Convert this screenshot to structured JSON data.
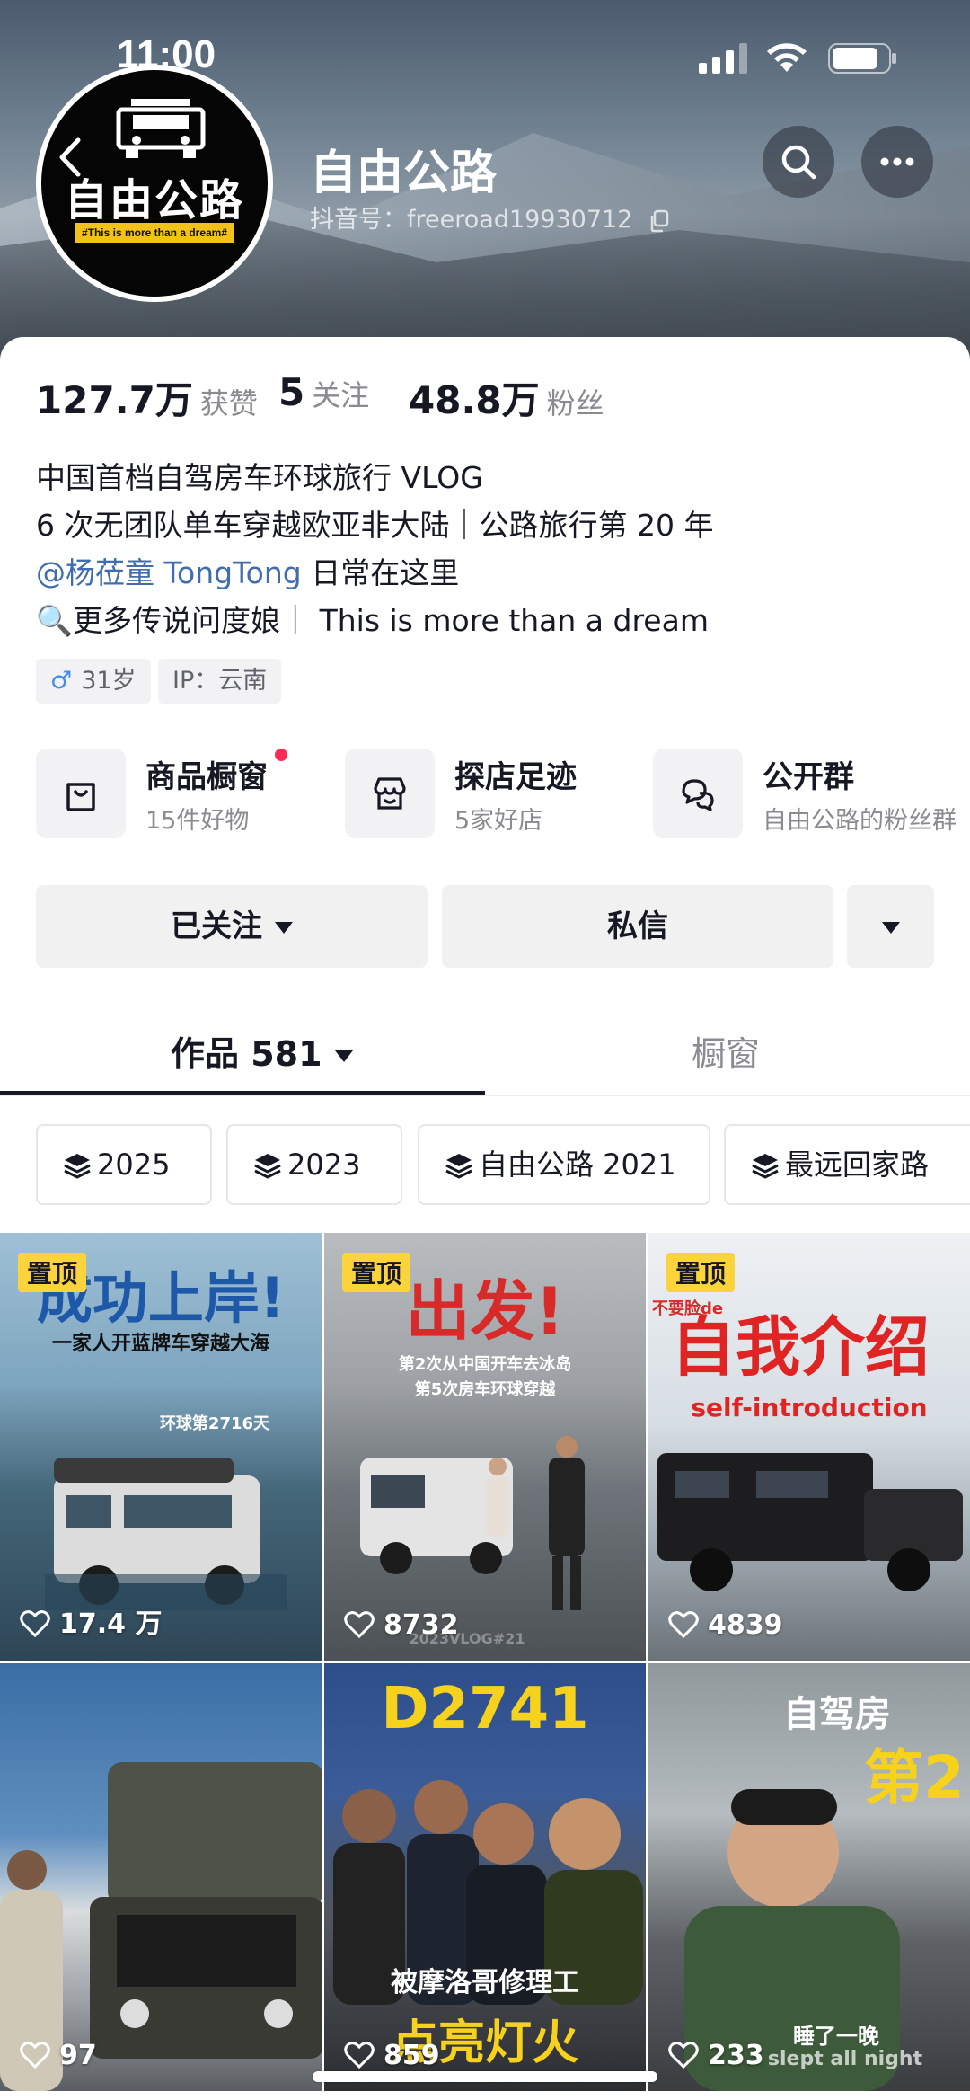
{
  "status_bar": {
    "time": "11:00"
  },
  "profile": {
    "name": "自由公路",
    "handle": "抖音号：freeroad19930712",
    "avatar_logo_text": "自由公路",
    "avatar_logo_sub": "#This is more than a dream#"
  },
  "stats": [
    {
      "num": "127.7万",
      "label": "获赞"
    },
    {
      "num": "5",
      "label": "关注"
    },
    {
      "num": "48.8万",
      "label": "粉丝"
    }
  ],
  "bio": {
    "line1": "中国首档自驾房车环球旅行 VLOG",
    "line2": "6 次无团队单车穿越欧亚非大陆｜公路旅行第 20 年",
    "line3_mention": "@杨莅童 TongTong",
    "line3_rest": " 日常在这里",
    "line4": "🔍更多传说问度娘｜ This is more than a dream"
  },
  "tags": {
    "gender_icon": "♂",
    "age": "31岁",
    "ip": "IP：云南"
  },
  "services": [
    {
      "title": "商品橱窗",
      "sub": "15件好物",
      "icon": "bag-icon"
    },
    {
      "title": "探店足迹",
      "sub": "5家好店",
      "icon": "store-icon"
    },
    {
      "title": "公开群",
      "sub": "自由公路的粉丝群",
      "icon": "chat-icon"
    }
  ],
  "actions": {
    "follow": "已关注",
    "message": "私信"
  },
  "tabs": {
    "works": "作品 581",
    "showcase": "橱窗"
  },
  "chips": [
    "2025",
    "2023",
    "自由公路 2021",
    "最远回家路"
  ],
  "videos": [
    {
      "pinned": "置顶",
      "headline": "成功上岸!",
      "sub": "一家人开蓝牌车穿越大海",
      "note": "环球第2716天",
      "likes": "17.4 万"
    },
    {
      "pinned": "置顶",
      "headline": "出发!",
      "sub": "第2次从中国开车去冰岛",
      "sub2": "第5次房车环球穿越",
      "note": "2023VLOG#21",
      "likes": "8732"
    },
    {
      "pinned": "置顶",
      "headline": "自我介绍",
      "pre": "不要脸de",
      "sub": "self-introduction",
      "likes": "4839"
    },
    {
      "likes": "97"
    },
    {
      "headline": "D2741",
      "sub": "被摩洛哥修理工",
      "sub2": "点亮灯火",
      "likes": "859"
    },
    {
      "headline": "自驾房",
      "sub": "第2",
      "note": "睡了一晚",
      "note2": "slept all night",
      "likes": "233"
    }
  ],
  "colors": {
    "accent_red": "#fe2c55",
    "mention_blue": "#3f6db0",
    "pin_yellow": "#fbd33b"
  }
}
